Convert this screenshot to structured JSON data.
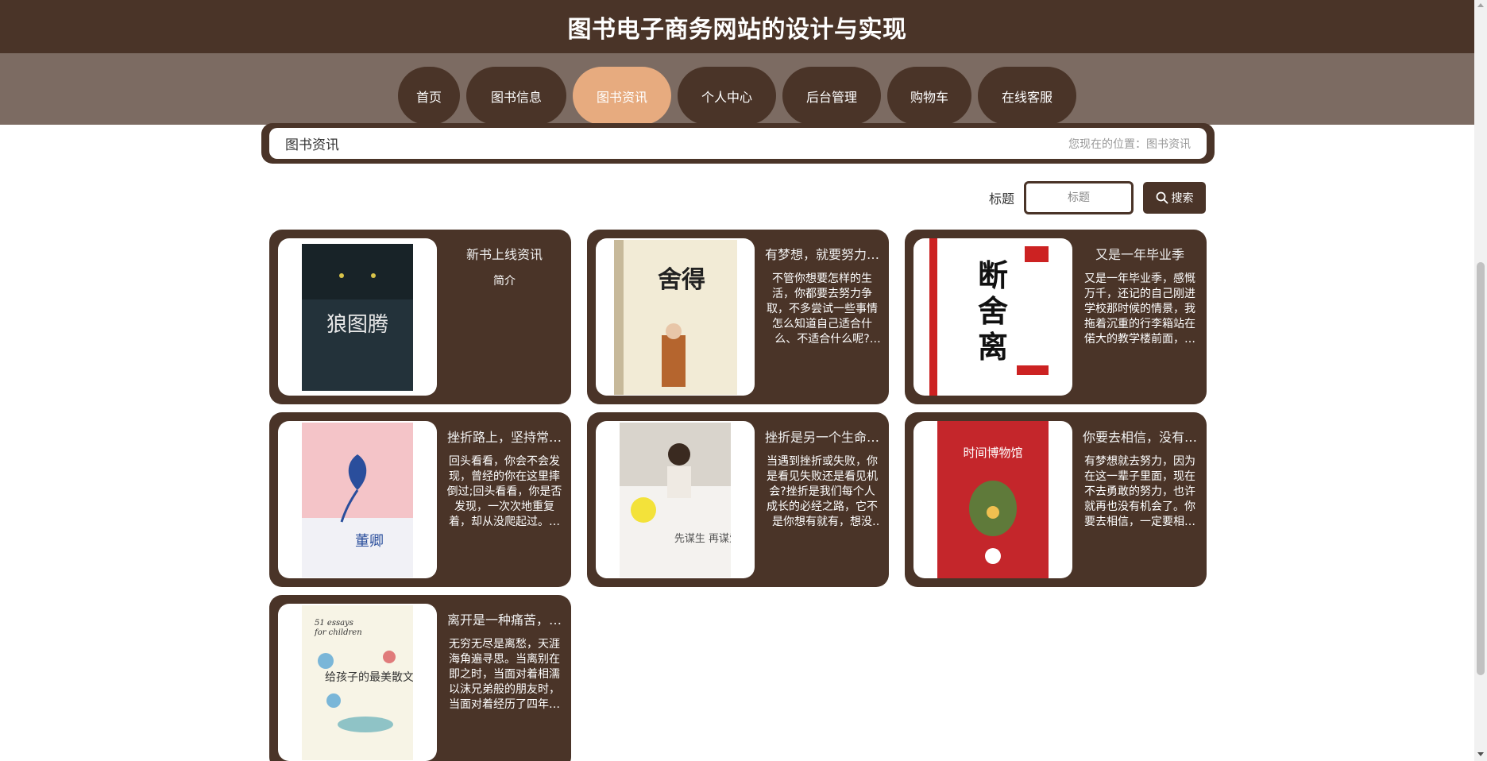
{
  "header": {
    "title": "图书电子商务网站的设计与实现"
  },
  "nav": [
    {
      "label": "首页",
      "active": false
    },
    {
      "label": "图书信息",
      "active": false
    },
    {
      "label": "图书资讯",
      "active": true
    },
    {
      "label": "个人中心",
      "active": false
    },
    {
      "label": "后台管理",
      "active": false
    },
    {
      "label": "购物车",
      "active": false
    },
    {
      "label": "在线客服",
      "active": false
    }
  ],
  "breadcrumb": {
    "title": "图书资讯",
    "position": "您现在的位置：图书资讯"
  },
  "search": {
    "label": "标题",
    "placeholder": "标题",
    "button_label": "搜索"
  },
  "articles": [
    {
      "title": "新书上线资讯",
      "desc": "",
      "sub": "简介",
      "cover_text": "狼图腾"
    },
    {
      "title": "有梦想，就要努力…",
      "desc": "不管你想要怎样的生活，你都要去努力争取，不多尝试一些事情怎么知道自己适合什么、不适合什么呢?你…",
      "sub": "",
      "cover_text": "舍得"
    },
    {
      "title": "又是一年毕业季",
      "desc": "又是一年毕业季，感慨万千，还记的自己刚进学校那时候的情景，我拖着沉重的行李箱站在偌大的教学楼前面，…",
      "sub": "",
      "cover_text": "断舍离"
    },
    {
      "title": "挫折路上，坚持常…",
      "desc": "回头看看，你会不会发现，曾经的你在这里摔倒过;回头看看，你是否发现，一次次地重复着，却从没爬起过。…",
      "sub": "",
      "cover_text": "董卿"
    },
    {
      "title": "挫折是另一个生命…",
      "desc": "当遇到挫折或失败，你是看见失败还是看见机会?挫折是我们每个人成长的必经之路，它不是你想有就有，想没有…",
      "sub": "",
      "cover_text": "先谋生 再谋爱"
    },
    {
      "title": "你要去相信，没有…",
      "desc": "有梦想就去努力，因为在这一辈子里面，现在不去勇敢的努力，也许就再也没有机会了。你要去相信，一定要相…",
      "sub": "",
      "cover_text": "时间博物馆"
    },
    {
      "title": "离开是一种痛苦，…",
      "desc": "无穷无尽是离愁，天涯海角遍寻思。当离别在即之时，当面对着相濡以沫兄弟般的朋友时，当面对着经历了四年…",
      "sub": "",
      "cover_text": "给孩子的最美散文"
    }
  ],
  "colors": {
    "primary": "#4a3428",
    "nav_bg": "#7c6b62",
    "active": "#e7ab7f"
  }
}
